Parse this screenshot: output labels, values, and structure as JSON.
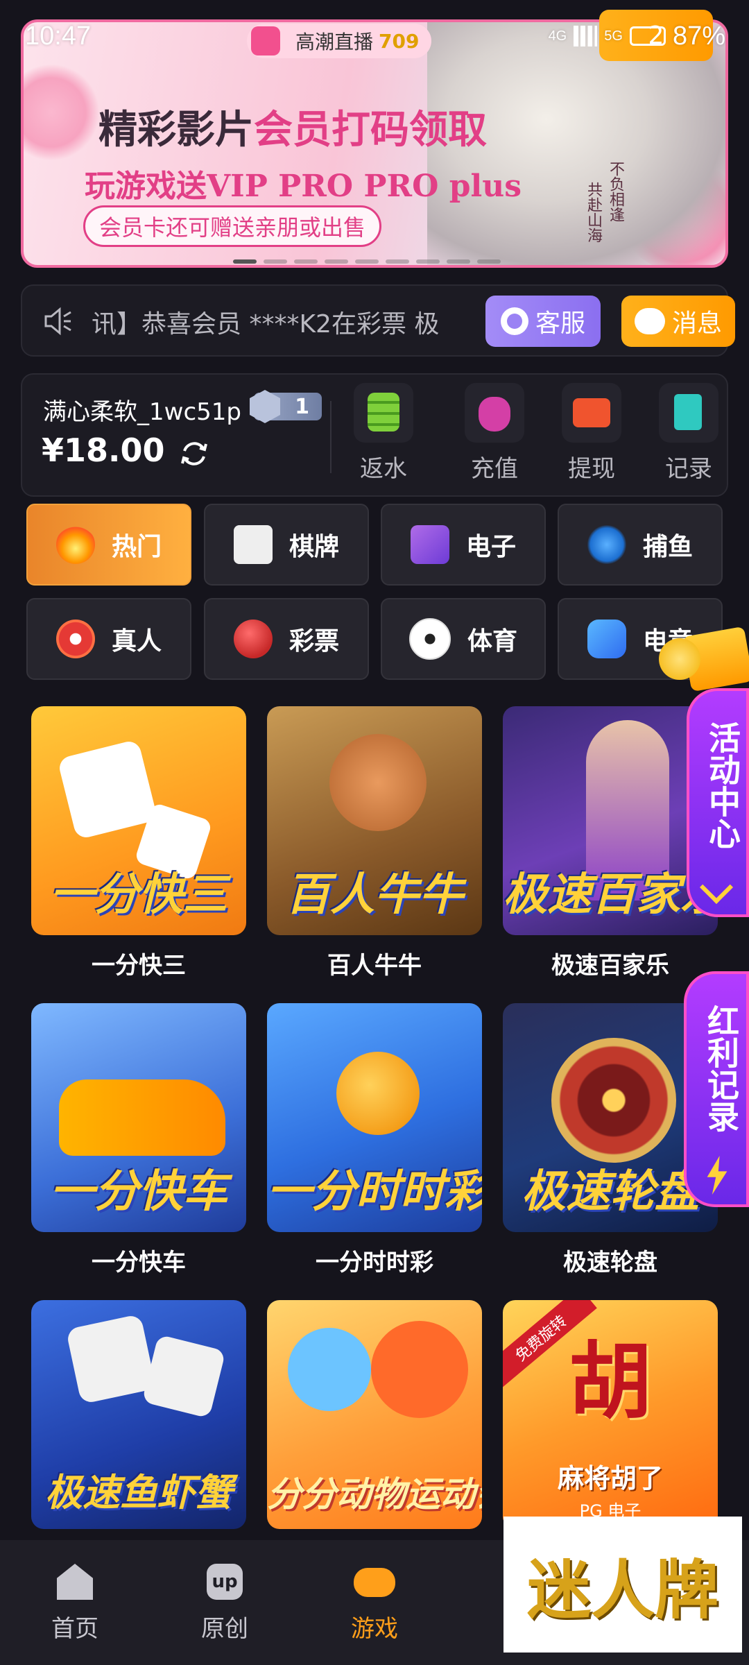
{
  "status_bar": {
    "time": "10:47",
    "battery": "87%",
    "net1": "4G",
    "net2": "5G"
  },
  "live_pill": {
    "label": "高潮直播",
    "count": "709"
  },
  "banner": {
    "title_plain": "精彩影片",
    "title_pink": "会员打码领取",
    "subtitle": "玩游戏送VIP PRO PRO plus",
    "pill": "会员卡还可赠送亲朋或出售",
    "vert1": "不负相逢",
    "vert2": "共赴山海",
    "slide_count": 9,
    "active_slide": 0
  },
  "notice": {
    "text": "讯】恭喜会员 ****K2在彩票 极",
    "service_label": "客服",
    "message_label": "消息",
    "message_badge": "2"
  },
  "account": {
    "username": "满心柔软_1wc51p",
    "vip_level": "1",
    "balance": "¥18.00",
    "actions": [
      {
        "label": "返水",
        "icon": "coin-stack-icon"
      },
      {
        "label": "充值",
        "icon": "money-bag-icon"
      },
      {
        "label": "提现",
        "icon": "wallet-icon"
      },
      {
        "label": "记录",
        "icon": "record-icon"
      }
    ]
  },
  "categories": [
    {
      "label": "热门",
      "icon": "fire-icon",
      "active": true
    },
    {
      "label": "棋牌",
      "icon": "mahjong-icon"
    },
    {
      "label": "电子",
      "icon": "slot-machine-icon"
    },
    {
      "label": "捕鱼",
      "icon": "shark-icon"
    },
    {
      "label": "真人",
      "icon": "poker-chip-icon"
    },
    {
      "label": "彩票",
      "icon": "lottery-ball-icon"
    },
    {
      "label": "体育",
      "icon": "soccer-ball-icon"
    },
    {
      "label": "电竞",
      "icon": "gamepad-icon"
    }
  ],
  "games": [
    {
      "title": "一分快三",
      "art": "一分快三"
    },
    {
      "title": "百人牛牛",
      "art": "百人牛牛"
    },
    {
      "title": "极速百家乐",
      "art": "极速百家乐"
    },
    {
      "title": "一分快车",
      "art": "一分快车"
    },
    {
      "title": "一分时时彩",
      "art": "一分时时彩"
    },
    {
      "title": "极速轮盘",
      "art": "极速轮盘"
    },
    {
      "title": "",
      "art": "极速鱼虾蟹"
    },
    {
      "title": "",
      "art": "分分动物运动会"
    },
    {
      "title": "",
      "art": "胡",
      "caption": "麻将胡了",
      "sub": "PG 电子",
      "ribbon": "免费旋转"
    }
  ],
  "floating": {
    "activity_center": "活动中心",
    "bonus_record": "红利记录"
  },
  "bottom_nav": [
    {
      "label": "首页",
      "icon": "home-icon"
    },
    {
      "label": "原创",
      "icon": "up-icon"
    },
    {
      "label": "游戏",
      "icon": "gamepad-icon",
      "active": true
    }
  ],
  "overlay_logo": "迷人牌",
  "colors": {
    "accent": "#ff9f1a",
    "background": "#15141c",
    "pink": "#e23f86"
  }
}
